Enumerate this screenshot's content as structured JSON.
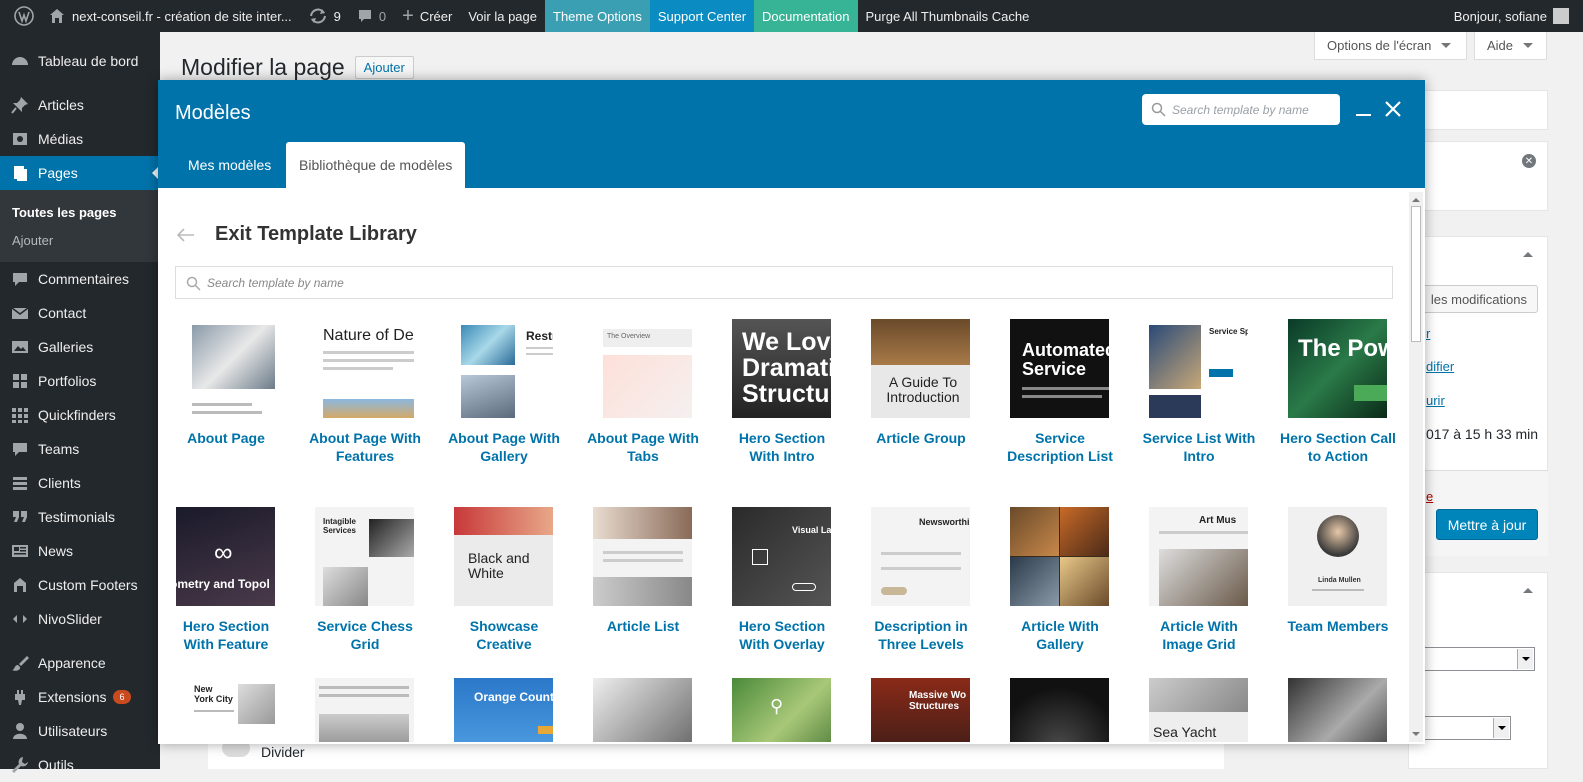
{
  "adminbar": {
    "site_name": "next-conseil.fr - création de site inter...",
    "updates_count": "9",
    "comments_count": "0",
    "new_label": "Créer",
    "view_page": "Voir la page",
    "theme_options": "Theme Options",
    "support_center": "Support Center",
    "documentation": "Documentation",
    "purge": "Purge All Thumbnails Cache",
    "greeting": "Bonjour, sofiane"
  },
  "sidebar": {
    "items": [
      {
        "label": "Tableau de bord",
        "icon": "dashboard-icon"
      },
      {
        "label": "Articles",
        "icon": "pin-icon"
      },
      {
        "label": "Médias",
        "icon": "media-icon"
      },
      {
        "label": "Pages",
        "icon": "pages-icon",
        "active": true
      },
      {
        "label": "Commentaires",
        "icon": "comments-icon"
      },
      {
        "label": "Contact",
        "icon": "mail-icon"
      },
      {
        "label": "Galleries",
        "icon": "gallery-icon"
      },
      {
        "label": "Portfolios",
        "icon": "grid-icon"
      },
      {
        "label": "Quickfinders",
        "icon": "grid-small-icon"
      },
      {
        "label": "Teams",
        "icon": "comment-icon"
      },
      {
        "label": "Clients",
        "icon": "list-icon"
      },
      {
        "label": "Testimonials",
        "icon": "quote-icon"
      },
      {
        "label": "News",
        "icon": "news-icon"
      },
      {
        "label": "Custom Footers",
        "icon": "footer-icon"
      },
      {
        "label": "NivoSlider",
        "icon": "slider-icon"
      },
      {
        "label": "Apparence",
        "icon": "brush-icon"
      },
      {
        "label": "Extensions",
        "icon": "plugin-icon",
        "badge": "6"
      },
      {
        "label": "Utilisateurs",
        "icon": "user-icon"
      },
      {
        "label": "Outils",
        "icon": "tools-icon"
      }
    ],
    "submenu": {
      "all_pages": "Toutes les pages",
      "add": "Ajouter"
    }
  },
  "page": {
    "title": "Modifier la page",
    "add_button": "Ajouter",
    "screen_options": "Options de l'écran",
    "help": "Aide",
    "save_changes": "les modifications",
    "link1": "r",
    "link2": "difier",
    "link3": "urir",
    "date_text": "017 à 15 h 33 min",
    "trash_link": "e",
    "update_button": "Mettre à jour",
    "divider_label": "Divider"
  },
  "modal": {
    "title": "Modèles",
    "search_placeholder": "Search template by name",
    "tabs": [
      "Mes modèles",
      "Bibliothèque de modèles"
    ],
    "exit_label": "Exit Template Library",
    "library_search_placeholder": "Search template by name",
    "templates": [
      {
        "label": "About Page"
      },
      {
        "label": "About Page With Features",
        "thumb_text": "Nature of De"
      },
      {
        "label": "About Page With Gallery",
        "thumb_text": "Restr"
      },
      {
        "label": "About Page With Tabs",
        "thumb_text": "The Overview"
      },
      {
        "label": "Hero Section With Intro",
        "thumb_text": "We Love Dramatic Structure"
      },
      {
        "label": "Article Group",
        "thumb_text": "A Guide To Introduction"
      },
      {
        "label": "Service Description List",
        "thumb_text": "Automated Service"
      },
      {
        "label": "Service List With Intro",
        "thumb_text": "Service Spec"
      },
      {
        "label": "Hero Section Call to Action",
        "thumb_text": "The Pow"
      },
      {
        "label": "Hero Section With Feature",
        "thumb_text": "ometry and Topol"
      },
      {
        "label": "Service Chess Grid",
        "thumb_text": "Intagible Services"
      },
      {
        "label": "Showcase Creative",
        "thumb_text": "Black and White"
      },
      {
        "label": "Article List"
      },
      {
        "label": "Hero Section With Overlay",
        "thumb_text": "Visual Lan"
      },
      {
        "label": "Description in Three Levels",
        "thumb_text": "Newsworthin"
      },
      {
        "label": "Article With Gallery"
      },
      {
        "label": "Article With Image Grid",
        "thumb_text": "Art Mus"
      },
      {
        "label": "Team Members",
        "thumb_text": "Linda Mullen"
      },
      {
        "thumb_text": "New York City"
      },
      {
        "thumb_text": ""
      },
      {
        "thumb_text": "Orange Count"
      },
      {
        "thumb_text": ""
      },
      {
        "thumb_text": ""
      },
      {
        "thumb_text": "Massive Wo Structures"
      },
      {
        "thumb_text": ""
      },
      {
        "thumb_text": "Sea Yacht"
      },
      {
        "thumb_text": ""
      }
    ]
  }
}
